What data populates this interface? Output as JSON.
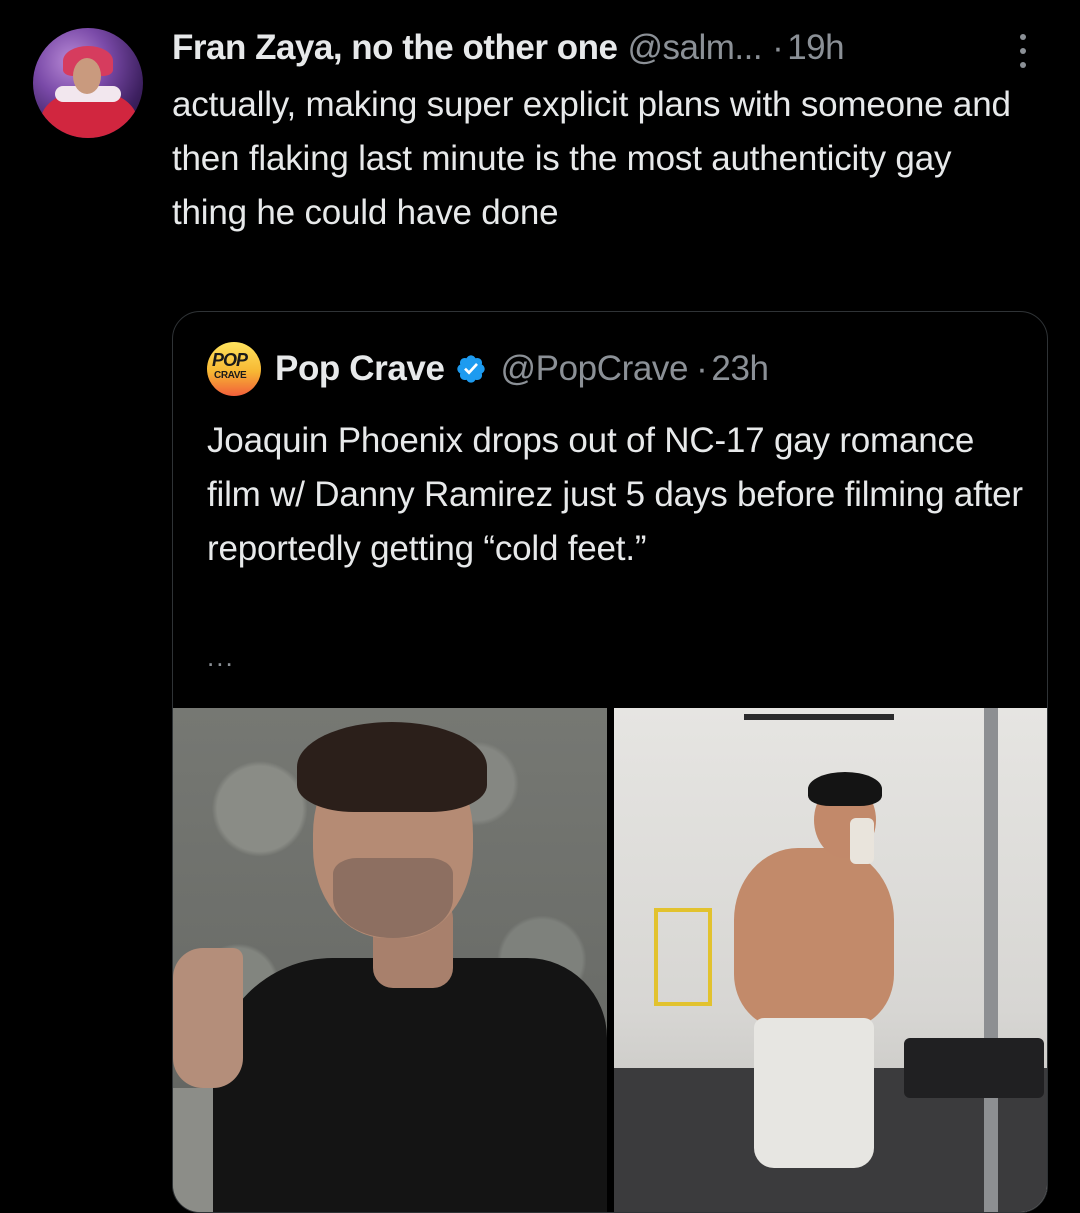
{
  "tweet": {
    "display_name": "Fran Zaya, no the other one",
    "handle": "@salm...",
    "separator": "·",
    "time": "19h",
    "text": "actually, making super explicit plans with someone and then flaking last minute is the most authenticity gay thing he could have done",
    "more_icon": "more-vertical-icon"
  },
  "quote": {
    "avatar_logo_top": "POP",
    "avatar_logo_bottom": "CRAVE",
    "display_name": "Pop Crave",
    "verified_icon": "verified-badge-icon",
    "handle": "@PopCrave",
    "separator": "·",
    "time": "23h",
    "text": "Joaquin Phoenix drops out of NC-17 gay romance film w/ Danny Ramirez just 5 days before filming after reportedly getting “cold feet.”",
    "more": "..."
  },
  "colors": {
    "background": "#000000",
    "primary_text": "#e7e9ea",
    "secondary_text": "#8b9096",
    "border": "#2f3336",
    "verified": "#1d9bf0"
  }
}
